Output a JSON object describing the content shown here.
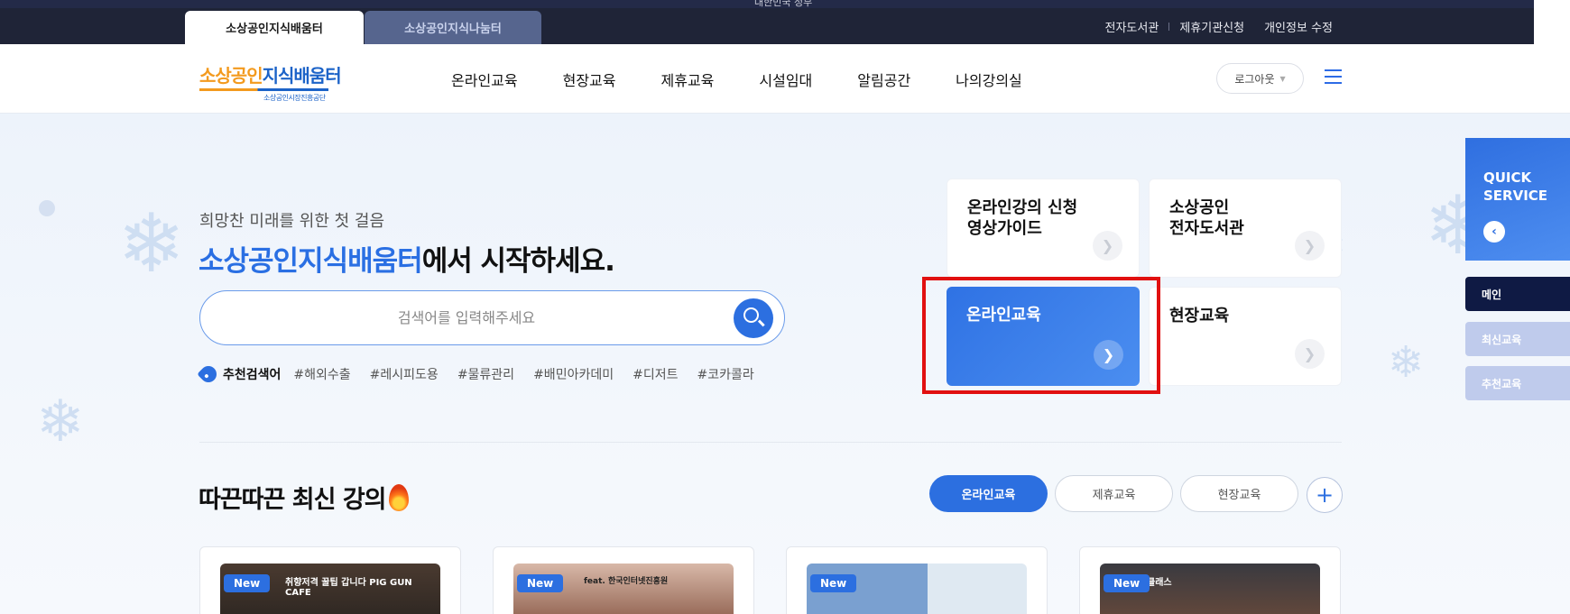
{
  "top_strip_text": "대한민국 정부",
  "site_tabs": [
    {
      "label": "소상공인지식배움터",
      "active": true
    },
    {
      "label": "소상공인지식나눔터",
      "active": false
    }
  ],
  "util_links": [
    "전자도서관",
    "제휴기관신청",
    "개인정보 수정"
  ],
  "logo": {
    "part1": "소상공인",
    "part2": "지식배움터",
    "org": "소상공인시장진흥공단"
  },
  "gnb": [
    "온라인교육",
    "현장교육",
    "제휴교육",
    "시설임대",
    "알림공간",
    "나의강의실"
  ],
  "header": {
    "logout_label": "로그아웃"
  },
  "hero": {
    "sub_heading": "희망찬 미래를 위한 첫 걸음",
    "heading_highlight": "소상공인지식배움터",
    "heading_rest": "에서 시작하세요.",
    "search_placeholder": "검색어를 입력해주세요",
    "recommend_label": "추천검색어",
    "keywords": [
      "#해외수출",
      "#레시피도용",
      "#물류관리",
      "#배민아카데미",
      "#디저트",
      "#코카콜라"
    ]
  },
  "quick_cards": [
    {
      "title": "온라인강의 신청\n영상가이드"
    },
    {
      "title": "소상공인\n전자도서관"
    },
    {
      "title": "온라인교육"
    },
    {
      "title": "현장교육"
    }
  ],
  "quick_service": {
    "title": "QUICK\nSERVICE",
    "menu": [
      "메인",
      "최신교육",
      "추천교육"
    ]
  },
  "latest": {
    "title": "따끈따끈 최신 강의",
    "filters": [
      "온라인교육",
      "제휴교육",
      "현장교육"
    ],
    "courses": [
      {
        "badge": "New",
        "thumb_text": "취향저격 꿀팁 갑니다  PIG GUN CAFE"
      },
      {
        "badge": "New",
        "thumb_text": "feat. 한국인터넷진흥원"
      },
      {
        "badge": "New",
        "thumb_text": ""
      },
      {
        "badge": "New",
        "thumb_text": "클래스"
      }
    ]
  },
  "colors": {
    "accent": "#2c6fe0",
    "dark_bar": "#1f2437",
    "highlight": "#e11010"
  }
}
